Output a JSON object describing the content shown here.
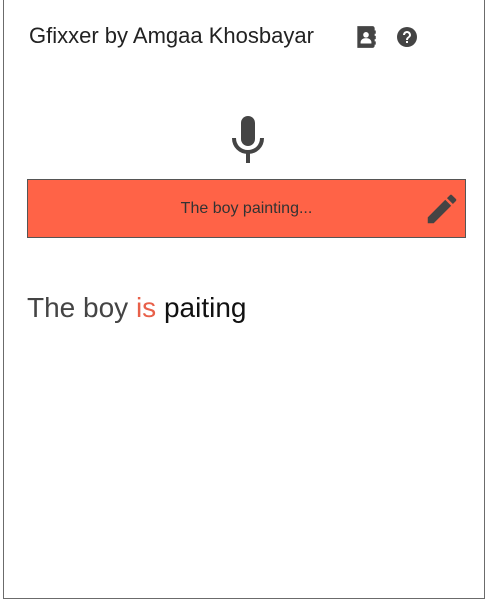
{
  "app": {
    "title": "Gfixxer by Amgaa Khosbayar"
  },
  "header": {
    "icons": [
      "contacts-book-icon",
      "help-circle-icon"
    ]
  },
  "input": {
    "text": "The boy painting...",
    "background_color": "#ff6347"
  },
  "result": {
    "words": [
      {
        "text": "The boy",
        "kind": "plain"
      },
      {
        "text": "is",
        "kind": "inserted"
      },
      {
        "text": "paiting",
        "kind": "misspelled"
      }
    ],
    "inserted_color": "#e8604a"
  }
}
